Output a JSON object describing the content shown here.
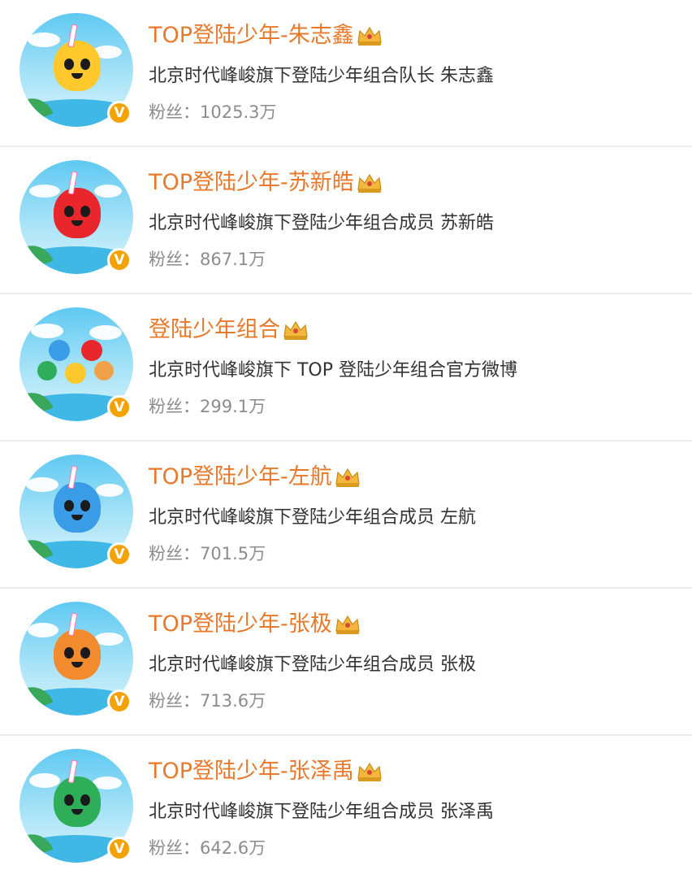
{
  "accounts": [
    {
      "name": "TOP登陆少年-朱志鑫",
      "desc": "北京时代峰峻旗下登陆少年组合队长 朱志鑫",
      "fans_label": "粉丝：",
      "fans": "1025.3万",
      "mascot_color": "#ffc92e"
    },
    {
      "name": "TOP登陆少年-苏新皓",
      "desc": "北京时代峰峻旗下登陆少年组合成员 苏新皓",
      "fans_label": "粉丝：",
      "fans": "867.1万",
      "mascot_color": "#e8262b"
    },
    {
      "name": "登陆少年组合",
      "desc": "北京时代峰峻旗下 TOP 登陆少年组合官方微博",
      "fans_label": "粉丝：",
      "fans": "299.1万",
      "mascot_color": "#f0a14a"
    },
    {
      "name": "TOP登陆少年-左航",
      "desc": "北京时代峰峻旗下登陆少年组合成员 左航",
      "fans_label": "粉丝：",
      "fans": "701.5万",
      "mascot_color": "#3a9be6"
    },
    {
      "name": "TOP登陆少年-张极",
      "desc": "北京时代峰峻旗下登陆少年组合成员 张极",
      "fans_label": "粉丝：",
      "fans": "713.6万",
      "mascot_color": "#f28a2e"
    },
    {
      "name": "TOP登陆少年-张泽禹",
      "desc": "北京时代峰峻旗下登陆少年组合成员 张泽禹",
      "fans_label": "粉丝：",
      "fans": "642.6万",
      "mascot_color": "#2fae5a"
    }
  ],
  "verified_badge": "V",
  "icons": {
    "verified": "verified-v-icon",
    "crown": "crown-icon"
  },
  "colors": {
    "name": "#e8792b",
    "desc": "#333333",
    "fans": "#8c8c8c",
    "badge": "#f4a200",
    "divider": "#ededed"
  }
}
